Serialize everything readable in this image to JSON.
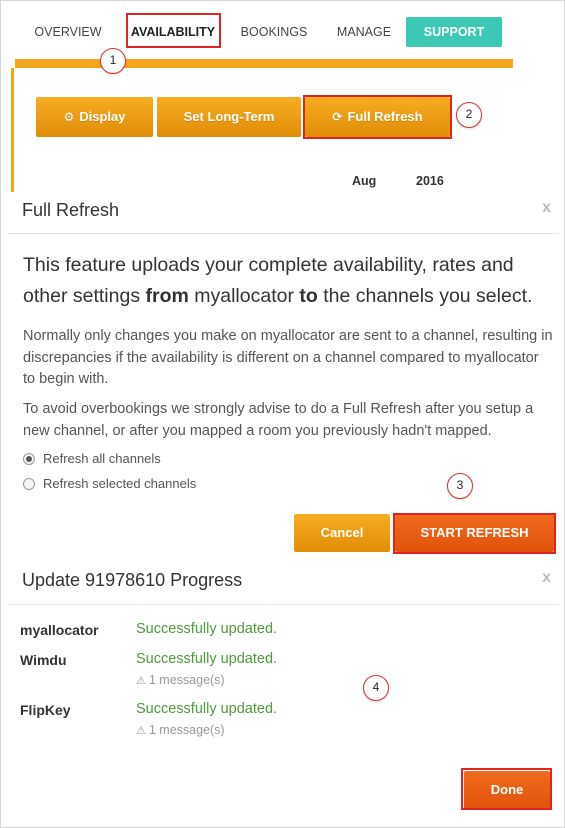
{
  "nav": {
    "items": [
      {
        "label": "OVERVIEW"
      },
      {
        "label": "AVAILABILITY"
      },
      {
        "label": "BOOKINGS"
      },
      {
        "label": "MANAGE"
      },
      {
        "label": "SUPPORT"
      }
    ]
  },
  "toolbar": {
    "display_label": "Display",
    "long_term_label": "Set Long-Term",
    "full_refresh_label": "Full Refresh",
    "display_icon": "gear-icon",
    "refresh_icon": "refresh-icon"
  },
  "calendar": {
    "month": "Aug",
    "year": "2016"
  },
  "full_refresh_modal": {
    "title": "Full Refresh",
    "close": "x",
    "lead_1": "This feature uploads your complete availability, rates and",
    "lead_2a": "other settings ",
    "lead_2b": "from",
    "lead_2c": " myallocator ",
    "lead_2d": "to",
    "lead_2e": " the channels you select.",
    "para_1": "Normally only changes you make on myallocator are sent to a channel, resulting in discrepancies if the availability is different on a channel compared to myallocator to begin with.",
    "para_2": "To avoid overbookings we strongly advise to do a Full Refresh after you setup a new channel, or after you mapped a room you previously hadn't mapped.",
    "options": [
      {
        "label": "Refresh all channels",
        "checked": true
      },
      {
        "label": "Refresh selected channels",
        "checked": false
      }
    ],
    "cancel_label": "Cancel",
    "start_label": "START REFRESH"
  },
  "progress_modal": {
    "title": "Update 91978610 Progress",
    "close": "x",
    "channels": [
      {
        "name": "myallocator",
        "status": "Successfully updated.",
        "message": ""
      },
      {
        "name": "Wimdu",
        "status": "Successfully updated.",
        "message": "1 message(s)"
      },
      {
        "name": "FlipKey",
        "status": "Successfully updated.",
        "message": "1 message(s)"
      }
    ],
    "done_label": "Done"
  },
  "callouts": [
    "1",
    "2",
    "3",
    "4"
  ],
  "colors": {
    "accent_orange": "#f3a51e",
    "start_orange": "#e65a12",
    "support_teal": "#3cc8b4",
    "highlight_red": "#e02424",
    "success_green": "#4f9a3f"
  }
}
